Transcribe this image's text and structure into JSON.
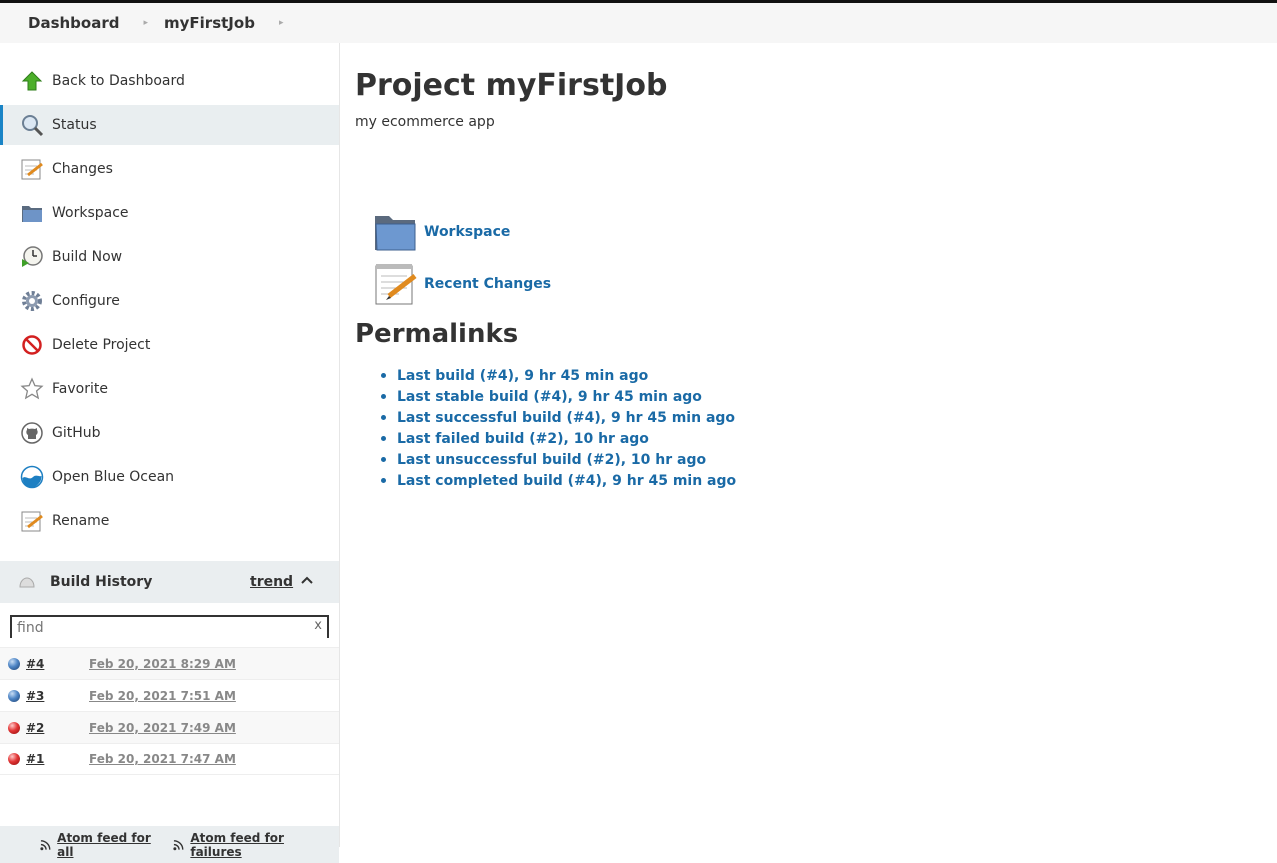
{
  "breadcrumb": {
    "items": [
      "Dashboard",
      "myFirstJob"
    ]
  },
  "sidebar": {
    "tasks": [
      {
        "label": "Back to Dashboard",
        "icon": "up-arrow-icon"
      },
      {
        "label": "Status",
        "icon": "magnifier-icon",
        "active": true
      },
      {
        "label": "Changes",
        "icon": "notepad-icon"
      },
      {
        "label": "Workspace",
        "icon": "folder-icon"
      },
      {
        "label": "Build Now",
        "icon": "clock-icon"
      },
      {
        "label": "Configure",
        "icon": "gear-icon"
      },
      {
        "label": "Delete Project",
        "icon": "no-entry-icon"
      },
      {
        "label": "Favorite",
        "icon": "star-icon"
      },
      {
        "label": "GitHub",
        "icon": "github-icon"
      },
      {
        "label": "Open Blue Ocean",
        "icon": "blue-ocean-icon"
      },
      {
        "label": "Rename",
        "icon": "notepad-icon"
      }
    ]
  },
  "build_history": {
    "title": "Build History",
    "trend_label": "trend",
    "search_placeholder": "find",
    "clear_label": "x",
    "builds": [
      {
        "number": "#4",
        "date": "Feb 20, 2021 8:29 AM",
        "status": "blue"
      },
      {
        "number": "#3",
        "date": "Feb 20, 2021 7:51 AM",
        "status": "blue"
      },
      {
        "number": "#2",
        "date": "Feb 20, 2021 7:49 AM",
        "status": "red"
      },
      {
        "number": "#1",
        "date": "Feb 20, 2021 7:47 AM",
        "status": "red"
      }
    ],
    "feeds": {
      "all": "Atom feed for all",
      "failures": "Atom feed for failures"
    }
  },
  "main": {
    "title": "Project myFirstJob",
    "description": "my ecommerce app",
    "links": {
      "workspace": "Workspace",
      "recent_changes": "Recent Changes"
    },
    "permalinks_title": "Permalinks",
    "permalinks": [
      "Last build (#4), 9 hr 45 min ago",
      "Last stable build (#4), 9 hr 45 min ago",
      "Last successful build (#4), 9 hr 45 min ago",
      "Last failed build (#2), 10 hr ago",
      "Last unsuccessful build (#2), 10 hr ago",
      "Last completed build (#4), 9 hr 45 min ago"
    ]
  },
  "colors": {
    "link": "#1a6aa6",
    "active_bar": "#1a84c6",
    "panel_bg": "#eaeef0"
  }
}
